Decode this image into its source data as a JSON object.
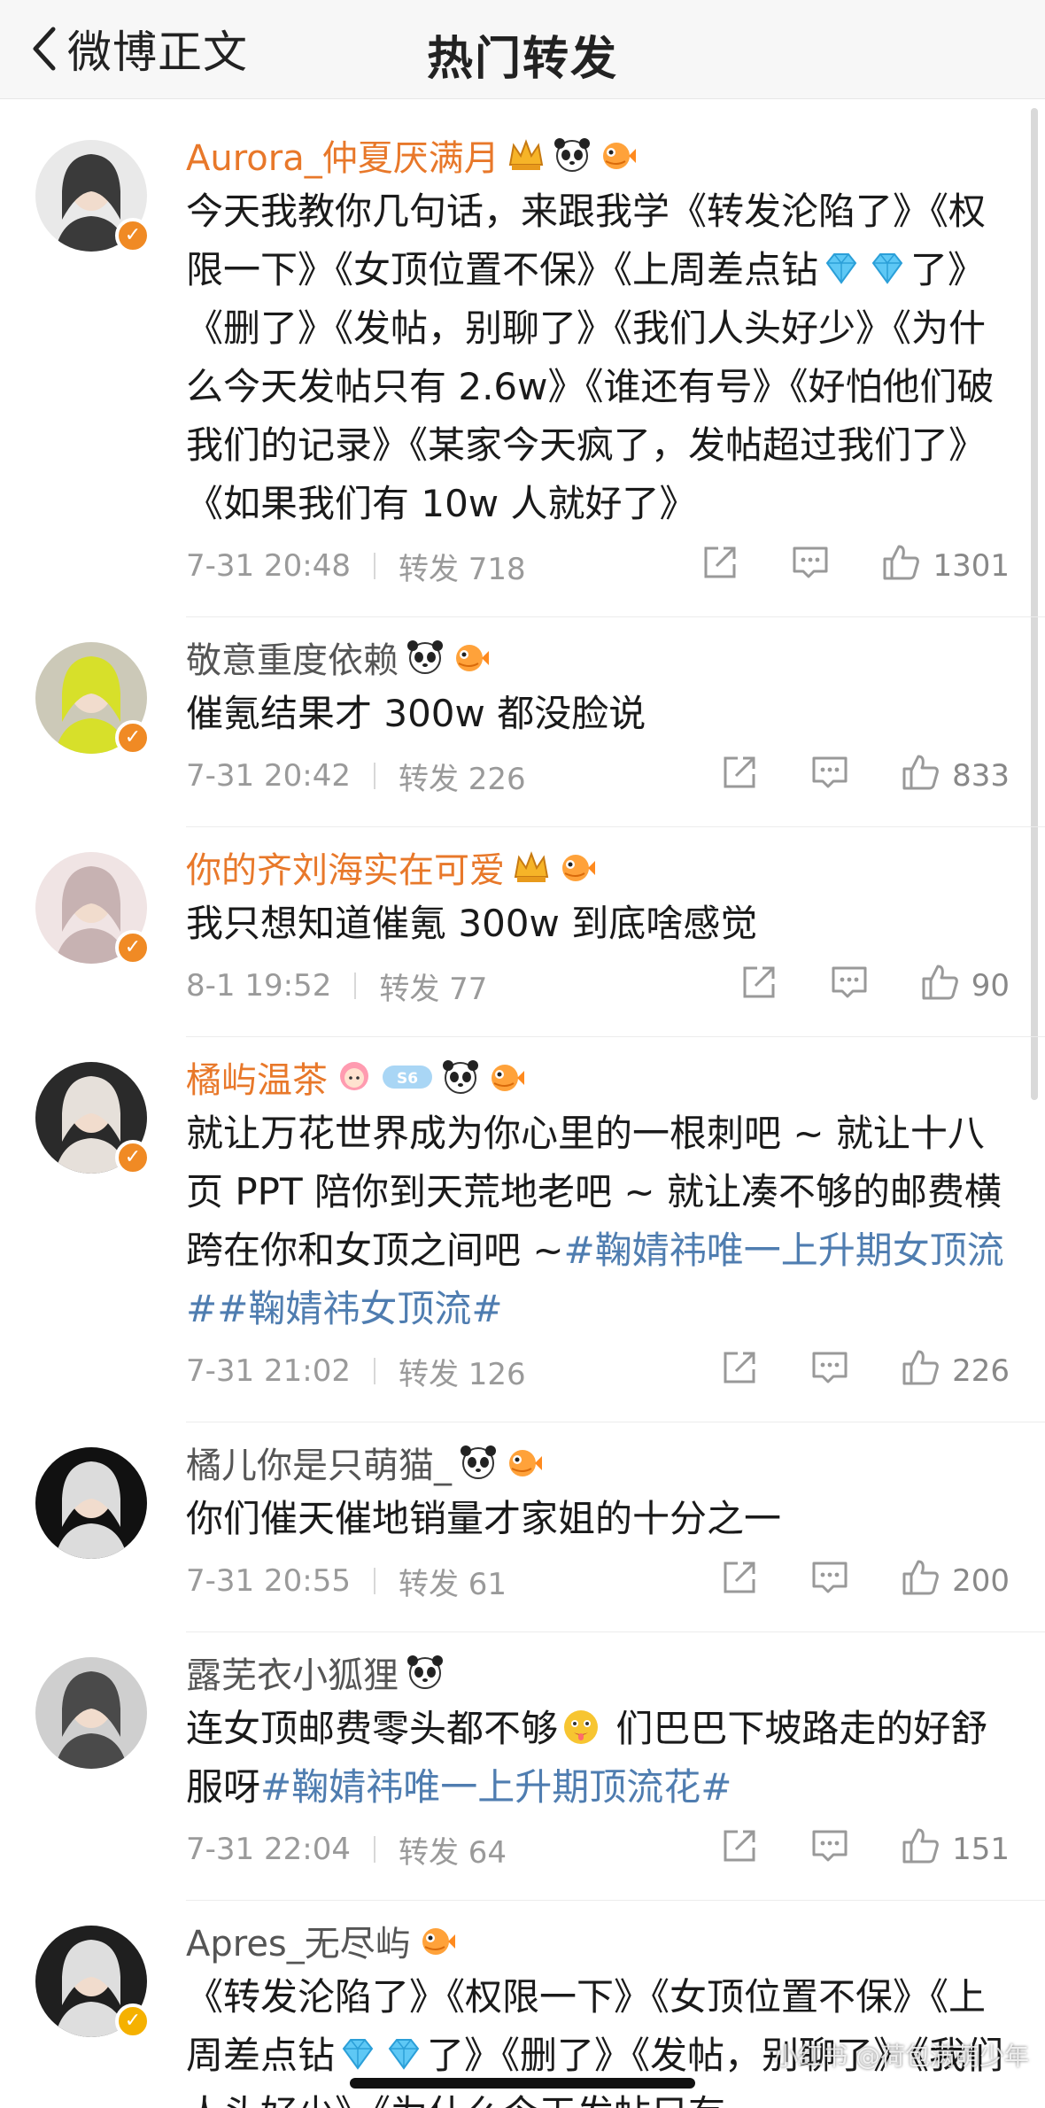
{
  "nav": {
    "back_label": "微博正文",
    "title": "热门转发"
  },
  "comments": [
    {
      "user": "Aurora_仲夏厌满月",
      "vip": true,
      "text_parts": [
        {
          "t": "今天我教你几句话，来跟我学《转发沦陷了》《权限一下》《女顶位置不保》《上周差点钻"
        },
        {
          "emo": "diamond"
        },
        {
          "emo": "diamond"
        },
        {
          "t": "了》《删了》《发帖，别聊了》《我们人头好少》《为什么今天发帖只有 2.6w》《谁还有号》《好怕他们破我们的记录》《某家今天疯了，发帖超过我们了》《如果我们有 10w 人就好了》"
        }
      ],
      "time": "7-31 20:48",
      "forward": "转发 718",
      "likes": "1301"
    },
    {
      "user": "敬意重度依赖",
      "vip": false,
      "text_parts": [
        {
          "t": "催氪结果才 300w 都没脸说"
        }
      ],
      "time": "7-31 20:42",
      "forward": "转发 226",
      "likes": "833"
    },
    {
      "user": "你的齐刘海实在可爱",
      "vip": true,
      "text_parts": [
        {
          "t": "我只想知道催氪 300w 到底啥感觉"
        }
      ],
      "time": "8-1 19:52",
      "forward": "转发 77",
      "likes": "90"
    },
    {
      "user": "橘屿温茶",
      "vip": true,
      "text_parts": [
        {
          "t": "就让万花世界成为你心里的一根刺吧 ~ 就让十八页 PPT 陪你到天荒地老吧 ~ 就让凑不够的邮费横跨在你和女顶之间吧 ~"
        },
        {
          "topic": "#鞠婧祎唯一上升期女顶流#"
        },
        {
          "topic": "#鞠婧祎女顶流#"
        }
      ],
      "time": "7-31 21:02",
      "forward": "转发 126",
      "likes": "226"
    },
    {
      "user": "橘儿你是只萌猫_",
      "vip": false,
      "text_parts": [
        {
          "t": "你们催天催地销量才家姐的十分之一"
        }
      ],
      "time": "7-31 20:55",
      "forward": "转发 61",
      "likes": "200"
    },
    {
      "user": "露芜衣小狐狸",
      "vip": false,
      "text_parts": [
        {
          "t": "连女顶邮费零头都不够"
        },
        {
          "emo": "face"
        },
        {
          "t": " 们巴巴下坡路走的好舒服呀"
        },
        {
          "topic": "#鞠婧祎唯一上升期顶流花#"
        }
      ],
      "time": "7-31 22:04",
      "forward": "转发 64",
      "likes": "151"
    },
    {
      "user": "Apres_无尽屿",
      "vip": false,
      "text_parts": [
        {
          "t": "《转发沦陷了》《权限一下》《女顶位置不保》《上周差点钻"
        },
        {
          "emo": "diamond"
        },
        {
          "emo": "diamond"
        },
        {
          "t": "了》《删了》《发帖，别聊了》《我们人头好少》《为什么今天发帖只有"
        }
      ],
      "time": "",
      "forward": "",
      "likes": ""
    }
  ],
  "watermark": "小红书 @荷包满萌少年",
  "colors": {
    "vip_name": "#e8782a",
    "topic": "#4f7db0",
    "meta": "#9a9a9a",
    "badge": "#f08a24"
  }
}
